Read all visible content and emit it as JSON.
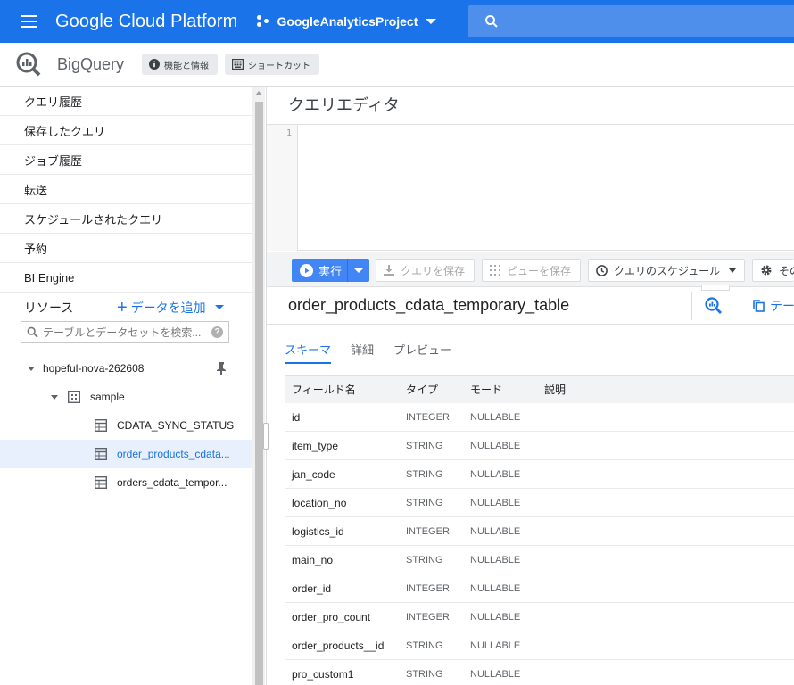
{
  "header": {
    "app_title": "Google Cloud Platform",
    "project": "GoogleAnalyticsProject",
    "search_placeholder": ""
  },
  "product": {
    "name": "BigQuery",
    "chips": [
      {
        "label": "機能と情報",
        "icon": "info-icon"
      },
      {
        "label": "ショートカット",
        "icon": "keyboard-icon"
      }
    ]
  },
  "sidebar": {
    "items": [
      {
        "label": "クエリ履歴"
      },
      {
        "label": "保存したクエリ"
      },
      {
        "label": "ジョブ履歴"
      },
      {
        "label": "転送"
      },
      {
        "label": "スケジュールされたクエリ"
      },
      {
        "label": "予約"
      },
      {
        "label": "BI Engine"
      }
    ],
    "resources_label": "リソース",
    "add_data_label": "データを追加",
    "search_placeholder": "テーブルとデータセットを検索...",
    "tree": {
      "project": "hopeful-nova-262608",
      "dataset": "sample",
      "tables": [
        {
          "label": "CDATA_SYNC_STATUS",
          "selected": false
        },
        {
          "label": "order_products_cdata...",
          "selected": true
        },
        {
          "label": "orders_cdata_tempor...",
          "selected": false
        }
      ]
    }
  },
  "editor": {
    "title": "クエリエディタ",
    "line_number": "1"
  },
  "toolbar": {
    "run_label": "実行",
    "save_query_label": "クエリを保存",
    "save_view_label": "ビューを保存",
    "schedule_label": "クエリのスケジュール",
    "more_label": "その"
  },
  "table_panel": {
    "table_name": "order_products_cdata_temporary_table",
    "copy_label": "テー",
    "tabs": [
      {
        "label": "スキーマ",
        "active": true
      },
      {
        "label": "詳細",
        "active": false
      },
      {
        "label": "プレビュー",
        "active": false
      }
    ],
    "columns": [
      "フィールド名",
      "タイプ",
      "モード",
      "説明"
    ],
    "rows": [
      {
        "name": "id",
        "type": "INTEGER",
        "mode": "NULLABLE",
        "desc": ""
      },
      {
        "name": "item_type",
        "type": "STRING",
        "mode": "NULLABLE",
        "desc": ""
      },
      {
        "name": "jan_code",
        "type": "STRING",
        "mode": "NULLABLE",
        "desc": ""
      },
      {
        "name": "location_no",
        "type": "STRING",
        "mode": "NULLABLE",
        "desc": ""
      },
      {
        "name": "logistics_id",
        "type": "INTEGER",
        "mode": "NULLABLE",
        "desc": ""
      },
      {
        "name": "main_no",
        "type": "STRING",
        "mode": "NULLABLE",
        "desc": ""
      },
      {
        "name": "order_id",
        "type": "INTEGER",
        "mode": "NULLABLE",
        "desc": ""
      },
      {
        "name": "order_pro_count",
        "type": "INTEGER",
        "mode": "NULLABLE",
        "desc": ""
      },
      {
        "name": "order_products__id",
        "type": "STRING",
        "mode": "NULLABLE",
        "desc": ""
      },
      {
        "name": "pro_custom1",
        "type": "STRING",
        "mode": "NULLABLE",
        "desc": ""
      }
    ]
  },
  "colors": {
    "brand_blue": "#1a73e8",
    "run_button": "#4285f4",
    "selected_bg": "#e8f0fe"
  }
}
